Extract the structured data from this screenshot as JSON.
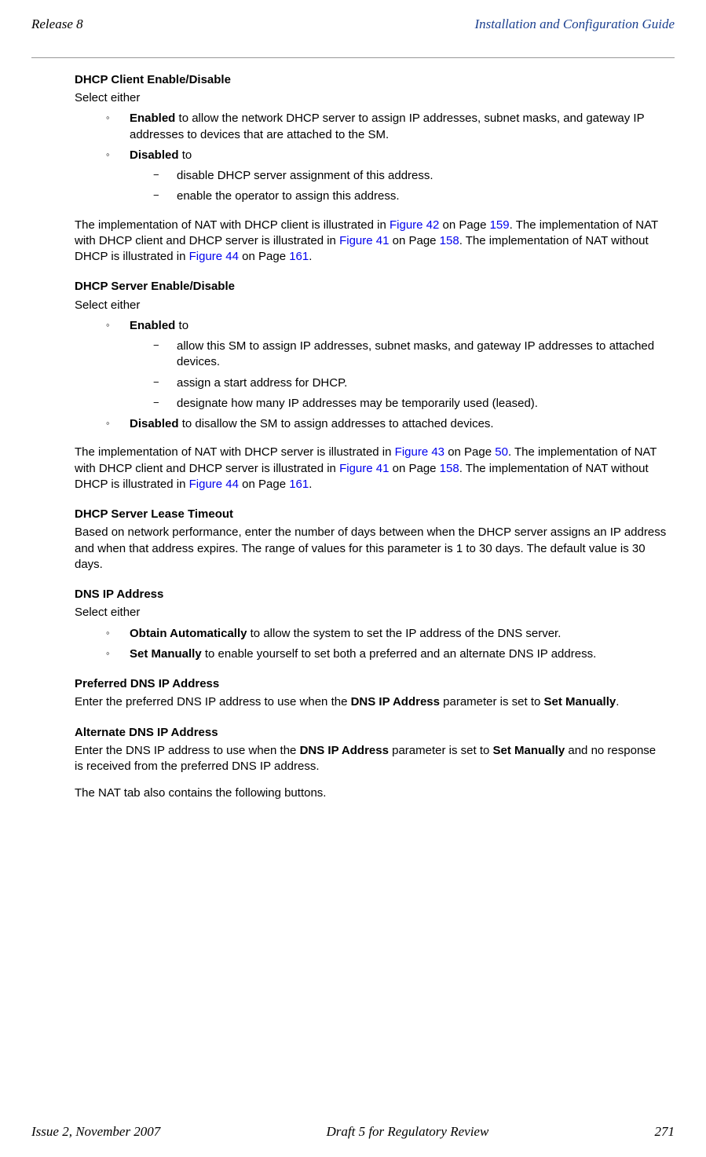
{
  "header": {
    "left": "Release 8",
    "right": "Installation and Configuration Guide"
  },
  "s1": {
    "heading": "DHCP Client Enable/Disable",
    "intro": "Select either",
    "item1_bold": "Enabled",
    "item1_text": " to allow the network DHCP server to assign IP addresses, subnet masks, and gateway IP addresses to devices that are attached to the SM.",
    "item2_bold": "Disabled",
    "item2_text": " to",
    "sub1": "disable DHCP server assignment of this address.",
    "sub2": "enable the operator to assign this address.",
    "para_a": "The implementation of NAT with DHCP client is illustrated in ",
    "para_b": "Figure 42",
    "para_c": " on Page ",
    "para_d": "159",
    "para_e": ". The implementation of NAT with DHCP client and DHCP server is illustrated in ",
    "para_f": "Figure 41",
    "para_g": " on Page ",
    "para_h": "158",
    "para_i": ". The implementation of NAT without DHCP is illustrated in ",
    "para_j": "Figure 44",
    "para_k": " on Page ",
    "para_l": "161",
    "para_m": "."
  },
  "s2": {
    "heading": "DHCP Server Enable/Disable",
    "intro": "Select either",
    "item1_bold": "Enabled",
    "item1_text": " to",
    "sub1": "allow this SM to assign IP addresses, subnet masks, and gateway IP addresses to attached devices.",
    "sub2": "assign a start address for DHCP.",
    "sub3": "designate how many IP addresses may be temporarily used (leased).",
    "item2_bold": "Disabled",
    "item2_text": " to disallow the SM to assign addresses to attached devices.",
    "para_a": "The implementation of NAT with DHCP server is illustrated in ",
    "para_b": "Figure 43",
    "para_c": " on Page ",
    "para_d": "50",
    "para_e": ". The implementation of NAT with DHCP client and DHCP server is illustrated in ",
    "para_f": "Figure 41",
    "para_g": " on Page ",
    "para_h": "158",
    "para_i": ". The implementation of NAT without DHCP is illustrated in ",
    "para_j": "Figure 44",
    "para_k": " on Page ",
    "para_l": "161",
    "para_m": "."
  },
  "s3": {
    "heading": "DHCP Server Lease Timeout",
    "para": "Based on network performance, enter the number of days between when the DHCP server assigns an IP address and when that address expires. The range of values for this parameter is 1 to 30 days. The default value is 30 days."
  },
  "s4": {
    "heading": "DNS IP Address",
    "intro": "Select either",
    "item1_bold": "Obtain Automatically",
    "item1_text": " to allow the system to set the IP address of the DNS server.",
    "item2_bold": "Set Manually",
    "item2_text": " to enable yourself to set both a preferred and an alternate DNS IP address."
  },
  "s5": {
    "heading": "Preferred DNS IP Address",
    "para_a": "Enter the preferred DNS IP address to use when the ",
    "para_b": "DNS IP Address",
    "para_c": " parameter is set to ",
    "para_d": "Set Manually",
    "para_e": "."
  },
  "s6": {
    "heading": "Alternate DNS IP Address",
    "para_a": "Enter the DNS IP address to use when the ",
    "para_b": "DNS IP Address",
    "para_c": " parameter is set to ",
    "para_d": "Set Manually",
    "para_e": " and no response is received from the preferred DNS IP address.",
    "para_final": "The NAT tab also contains the following buttons."
  },
  "footer": {
    "left": "Issue 2, November 2007",
    "center": "Draft 5 for Regulatory Review",
    "right": "271"
  }
}
